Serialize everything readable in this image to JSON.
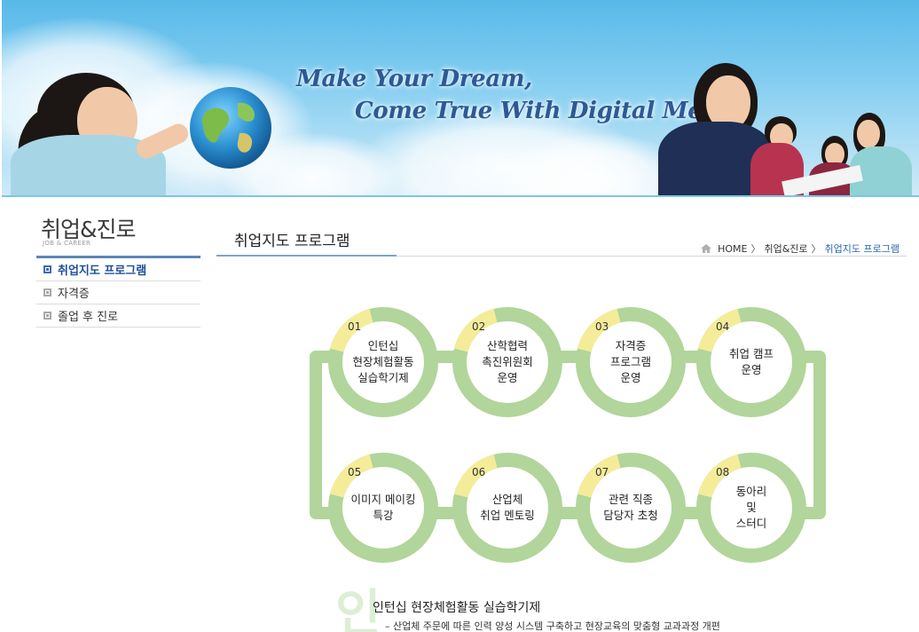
{
  "banner": {
    "tagline_1": "Make Your Dream,",
    "tagline_2": "Come True With Digital Media",
    "sky_color": "#7ccaf0",
    "tagline_color": "#2d5a94"
  },
  "sidebar": {
    "title": "취업&진로",
    "subtitle": "JOB & CAREER",
    "items": [
      {
        "label": "취업지도 프로그램",
        "active": true
      },
      {
        "label": "자격증",
        "active": false
      },
      {
        "label": "졸업 후 진로",
        "active": false
      }
    ]
  },
  "content": {
    "title": "취업지도 프로그램",
    "breadcrumb": {
      "home": "HOME",
      "sep": "〉",
      "section": "취업&진로",
      "current": "취업지도 프로그램"
    }
  },
  "diagram": {
    "ring_color": "#b1d59a",
    "badge_color": "#f5ec9a",
    "steps": [
      {
        "num": "01",
        "lines": [
          "인턴십",
          "현장체험활동",
          "실습학기제"
        ]
      },
      {
        "num": "02",
        "lines": [
          "산학협력",
          "촉진위원회",
          "운영"
        ]
      },
      {
        "num": "03",
        "lines": [
          "자격증",
          "프로그램",
          "운영"
        ]
      },
      {
        "num": "04",
        "lines": [
          "취업 캠프",
          "운영"
        ]
      },
      {
        "num": "05",
        "lines": [
          "이미지 메이킹",
          "특강"
        ]
      },
      {
        "num": "06",
        "lines": [
          "산업체",
          "취업 멘토링"
        ]
      },
      {
        "num": "07",
        "lines": [
          "관련 직종",
          "담당자 초청"
        ]
      },
      {
        "num": "08",
        "lines": [
          "동아리",
          "및",
          "스터디"
        ]
      }
    ]
  },
  "section": {
    "heading": "인턴십 현장체험활동 실습학기제",
    "description": "– 산업체 주문에 따른 인력 양성 시스템 구축하고 현장교육의 맞춤형 교과과정 개편",
    "watermark": "인"
  }
}
